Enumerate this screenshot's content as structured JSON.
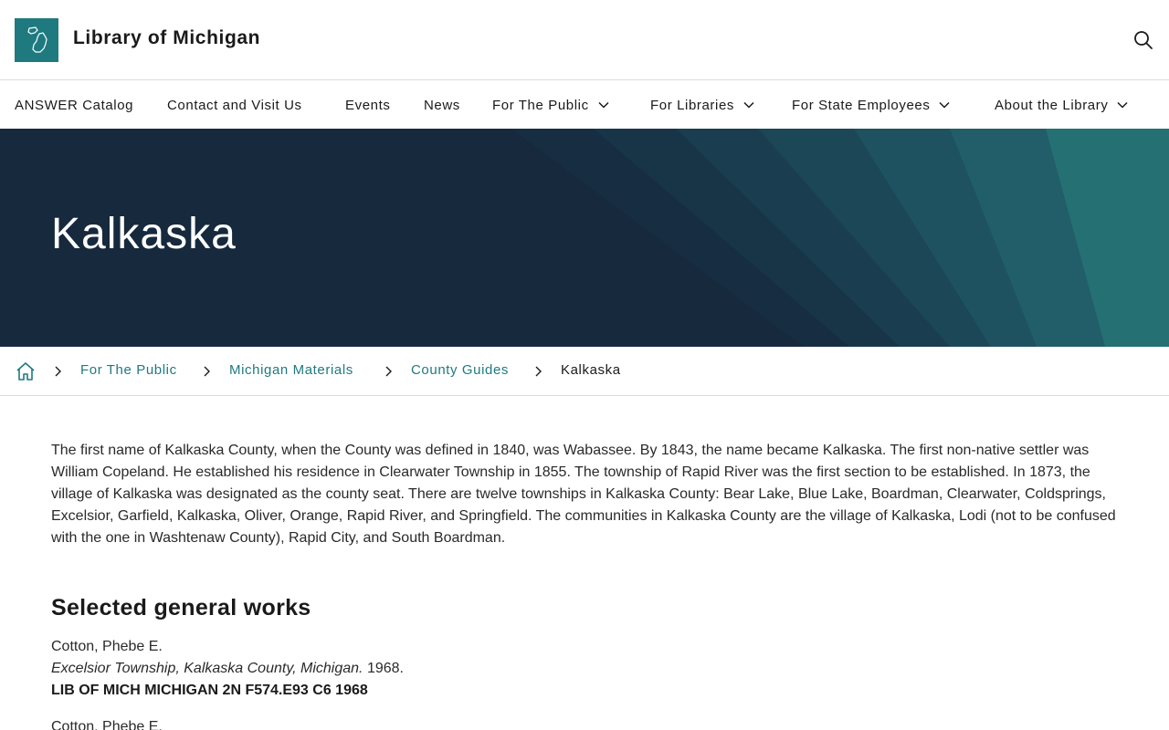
{
  "header": {
    "site_title": "Library of Michigan",
    "logo_icon": "michigan-map-icon",
    "search_icon": "search-icon"
  },
  "nav": {
    "items": [
      {
        "label": "ANSWER Catalog",
        "has_dropdown": false
      },
      {
        "label": "Contact and Visit Us",
        "has_dropdown": false
      },
      {
        "label": "Events",
        "has_dropdown": false
      },
      {
        "label": "News",
        "has_dropdown": false
      },
      {
        "label": "For The Public",
        "has_dropdown": true
      },
      {
        "label": "For Libraries",
        "has_dropdown": true
      },
      {
        "label": "For State Employees",
        "has_dropdown": true
      },
      {
        "label": "About the Library",
        "has_dropdown": true
      }
    ]
  },
  "hero": {
    "title": "Kalkaska"
  },
  "breadcrumb": {
    "home_icon": "home-icon",
    "links": [
      "For The Public",
      "Michigan Materials",
      "County Guides"
    ],
    "current": "Kalkaska"
  },
  "content": {
    "intro": "The first name of Kalkaska County, when the County was defined in 1840, was Wabassee.  By 1843, the name became Kalkaska. The first non-native settler was William Copeland.  He established his residence in Clearwater Township in 1855.  The township of Rapid River was the first section to be established.  In 1873, the village of Kalkaska was designated as the county seat. There are twelve townships in Kalkaska County: Bear Lake, Blue Lake, Boardman, Clearwater, Coldsprings, Excelsior, Garfield, Kalkaska, Oliver, Orange, Rapid River, and Springfield. The communities in Kalkaska County are the village of Kalkaska, Lodi (not to be confused with the one in Washtenaw County), Rapid City, and South Boardman.",
    "section_heading": "Selected general works",
    "works": [
      {
        "author": "Cotton, Phebe E.",
        "title": "Excelsior Township, Kalkaska County, Michigan.",
        "year": "1968.",
        "call_number": "LIB OF MICH MICHIGAN 2N  F574.E93 C6 1968"
      },
      {
        "author": "Cotton, Phebe E.",
        "title": "",
        "year": "",
        "call_number": ""
      }
    ]
  },
  "colors": {
    "brand_teal": "#1f7a80",
    "hero_navy": "#16293d",
    "link": "#1f7a80"
  }
}
